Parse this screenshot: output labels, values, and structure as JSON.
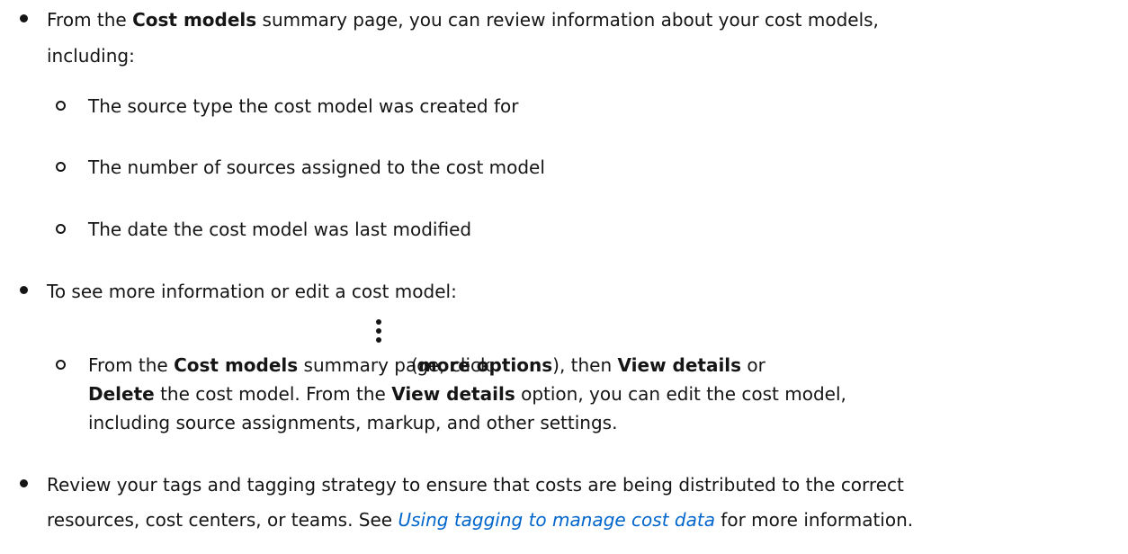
{
  "items": {
    "summary": {
      "prefix": "From the ",
      "bold": "Cost models",
      "suffix_line1": "summary page, you can review information about your cost models,",
      "line2": "including:",
      "subitems": [
        "The source type the cost model was created for",
        "The number of sources assigned to the cost model",
        "The date the cost model was last modified"
      ]
    },
    "edit": {
      "text": "To see more information or edit a cost model:",
      "sub": {
        "p1": "From the ",
        "b1": "Cost models",
        "p2": "summary page, click",
        "p3": "(",
        "b2": "more options",
        "p4": "), then ",
        "b3": "View details",
        "p5": " or",
        "b4": "Delete",
        "p6": " the cost model. From the ",
        "b5": "View details",
        "p7": " option, you can edit the cost model,",
        "line3": "including source assignments, markup, and other settings."
      }
    },
    "tags": {
      "line1": "Review your tags and tagging strategy to ensure that costs are being distributed to the correct",
      "line2_prefix": "resources, cost centers, or teams. See ",
      "link": "Using tagging to manage cost data",
      "line2_suffix": " for more information."
    }
  },
  "icons": {
    "more_options": "kebab-vertical-icon"
  }
}
